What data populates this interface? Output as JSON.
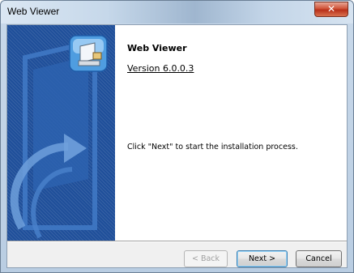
{
  "window": {
    "title": "Web Viewer"
  },
  "content": {
    "product_name": "Web Viewer",
    "version": "Version 6.0.0.3",
    "instruction": "Click \"Next\" to start the installation process."
  },
  "buttons": {
    "back": "< Back",
    "next": "Next >",
    "cancel": "Cancel"
  },
  "icons": {
    "close": "close-icon",
    "installer": "installer-icon",
    "banner": "banner-graphic"
  },
  "colors": {
    "banner": "#1f4f9a",
    "close": "#c9452b"
  }
}
